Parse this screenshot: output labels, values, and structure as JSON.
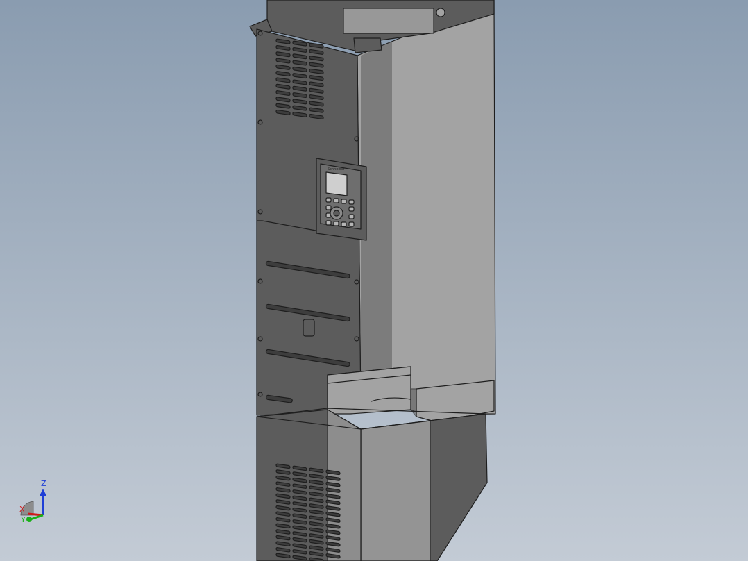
{
  "viewport": {
    "background_top": "#8a9cb0",
    "background_bottom": "#c3cbd5"
  },
  "model": {
    "body_light": "#a3a3a3",
    "body_dark": "#5c5c5c",
    "edge": "#1e1e1e",
    "vent_slot": "#3d3d3d"
  },
  "keypad": {
    "screen_color": "#cfcfcf",
    "brand_text": "Schneider"
  },
  "triad": {
    "z_label": "Z",
    "x_label": "X",
    "y_label": "Y",
    "z_color": "#1f3fd6",
    "x_color": "#d01818",
    "y_color": "#18b018"
  }
}
